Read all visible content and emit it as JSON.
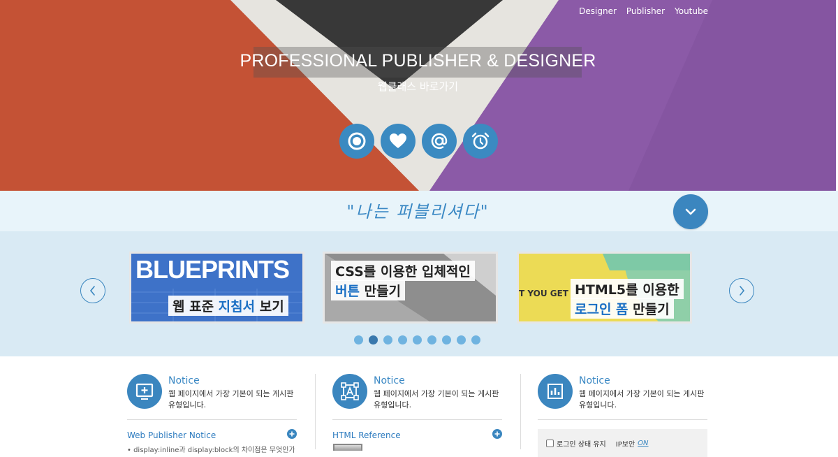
{
  "nav": {
    "links": [
      "Designer",
      "Publisher",
      "Youtube"
    ]
  },
  "hero": {
    "title": "PROFESSIONAL PUBLISHER & DESIGNER",
    "subtitle": "웹클래스 바로가기",
    "icons": [
      "target-icon",
      "heart-icon",
      "at-icon",
      "alarm-clock-icon"
    ]
  },
  "slogan": "\"나는 퍼블리셔다\"",
  "carousel": {
    "slides": [
      {
        "banner": "BLUEPRINTS",
        "cap_a": "웹 표준 ",
        "cap_b": "지침서",
        "cap_c": " 보기"
      },
      {
        "cap1": "CSS를 이용한 입체적인",
        "cap2_a": "버튼",
        "cap2_b": " 만들기"
      },
      {
        "tag": "T YOU GET",
        "cap1": "HTML5를 이용한",
        "cap2_a": "로그인 폼",
        "cap2_b": " 만들기"
      }
    ],
    "dots_count": 9,
    "active_dot_index": 1
  },
  "columns": [
    {
      "title": "Notice",
      "desc": "웹 페이지에서 가장 기본이 되는 게시판 유형입니다.",
      "link": "Web Publisher Notice",
      "item": "• display:inline과 display:block의 차이점은 무엇인가",
      "icon": "plus-box-icon"
    },
    {
      "title": "Notice",
      "desc": "웹 페이지에서 가장 기본이 되는 게시판 유형입니다.",
      "link": "HTML Reference",
      "icon": "text-frame-icon"
    },
    {
      "title": "Notice",
      "desc": "웹 페이지에서 가장 기본이 되는 게시판 유형입니다.",
      "icon": "bar-chart-icon",
      "login": {
        "keep": "로그인 상태 유지",
        "ip": "IP보안",
        "on": "ON"
      }
    }
  ],
  "colors": {
    "accent": "#3b86bf",
    "slogan_band": "#e8f4fa",
    "carousel_band": "#d9eaf4"
  }
}
